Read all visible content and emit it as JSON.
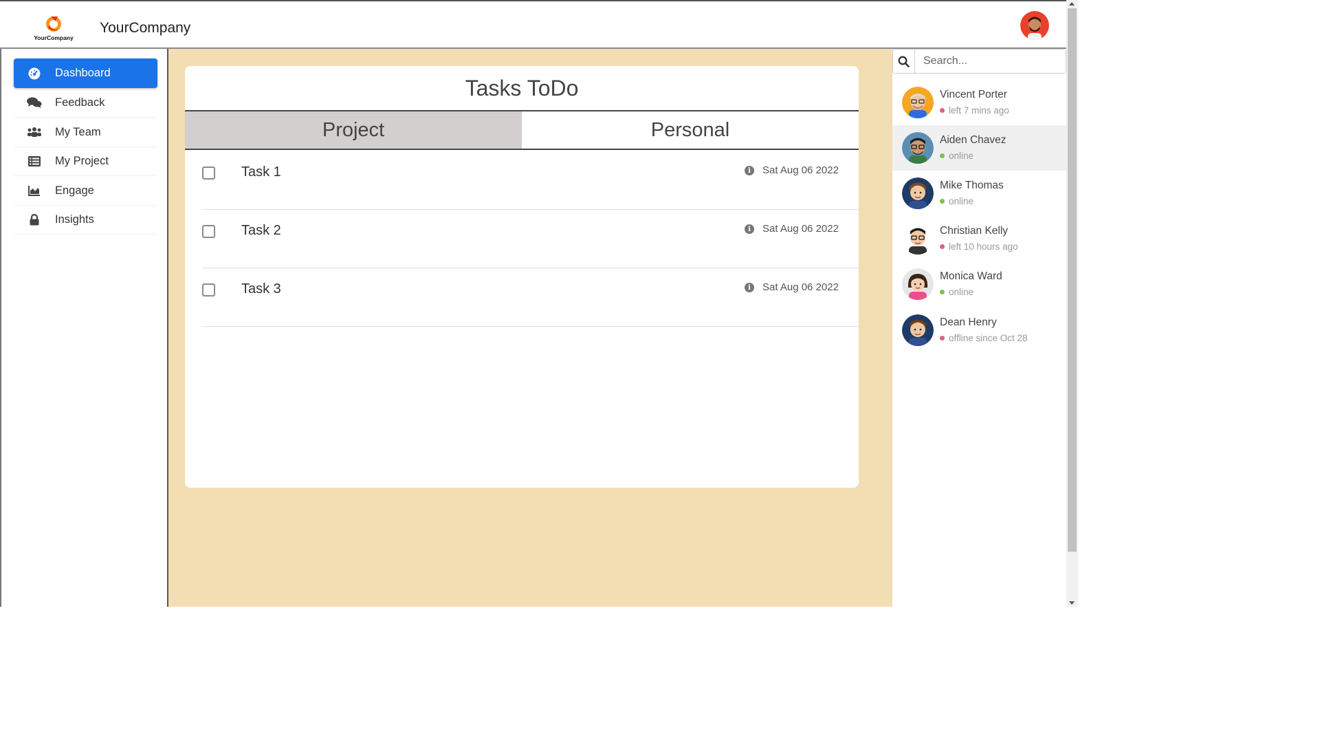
{
  "header": {
    "logo_text": "YourCompany",
    "company_name": "YourCompany"
  },
  "sidebar": {
    "items": [
      {
        "label": "Dashboard",
        "icon": "dashboard-icon",
        "active": true
      },
      {
        "label": "Feedback",
        "icon": "comments-icon",
        "active": false
      },
      {
        "label": "My Team",
        "icon": "users-icon",
        "active": false
      },
      {
        "label": "My Project",
        "icon": "list-icon",
        "active": false
      },
      {
        "label": "Engage",
        "icon": "area-chart-icon",
        "active": false
      },
      {
        "label": "Insights",
        "icon": "lock-icon",
        "active": false
      }
    ]
  },
  "main": {
    "title": "Tasks ToDo",
    "tabs": [
      {
        "label": "Project",
        "active": true
      },
      {
        "label": "Personal",
        "active": false
      }
    ],
    "tasks": [
      {
        "name": "Task 1",
        "date": "Sat Aug 06 2022",
        "checked": false
      },
      {
        "name": "Task 2",
        "date": "Sat Aug 06 2022",
        "checked": false
      },
      {
        "name": "Task 3",
        "date": "Sat Aug 06 2022",
        "checked": false
      }
    ]
  },
  "contacts_panel": {
    "search_placeholder": "Search...",
    "contacts": [
      {
        "name": "Vincent Porter",
        "status": "left 7 mins ago",
        "state": "offline"
      },
      {
        "name": "Aiden Chavez",
        "status": "online",
        "state": "online"
      },
      {
        "name": "Mike Thomas",
        "status": "online",
        "state": "online"
      },
      {
        "name": "Christian Kelly",
        "status": "left 10 hours ago",
        "state": "offline"
      },
      {
        "name": "Monica Ward",
        "status": "online",
        "state": "online"
      },
      {
        "name": "Dean Henry",
        "status": "offline since Oct 28",
        "state": "offline"
      }
    ]
  },
  "colors": {
    "accent": "#1a73e8",
    "main_bg": "#f3ddb2",
    "online": "#7cc24b",
    "offline": "#e0607e"
  }
}
